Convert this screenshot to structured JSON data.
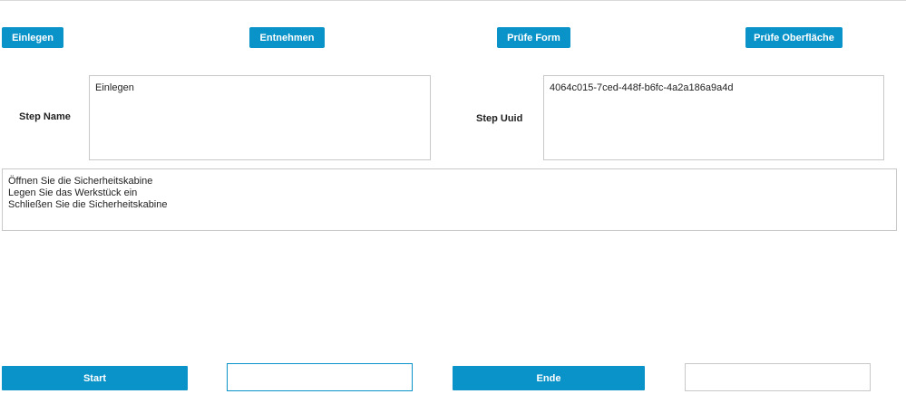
{
  "toolbar": {
    "buttons": [
      {
        "label": "Einlegen"
      },
      {
        "label": "Entnehmen"
      },
      {
        "label": "Prüfe Form"
      },
      {
        "label": "Prüfe Oberfläche"
      }
    ]
  },
  "step": {
    "name_label": "Step Name",
    "name_value": "Einlegen",
    "uuid_label": "Step Uuid",
    "uuid_value": "4064c015-7ced-448f-b6fc-4a2a186a9a4d"
  },
  "instructions": {
    "lines": [
      "Öffnen Sie die Sicherheitskabine",
      "Legen Sie das Werkstück ein",
      "Schließen Sie die Sicherheitskabine"
    ]
  },
  "controls": {
    "start_label": "Start",
    "start_input_value": "",
    "end_label": "Ende",
    "end_input_value": ""
  },
  "colors": {
    "accent": "#0a93c8",
    "border": "#c8c8c8",
    "input_border_active": "#0a93c8"
  }
}
